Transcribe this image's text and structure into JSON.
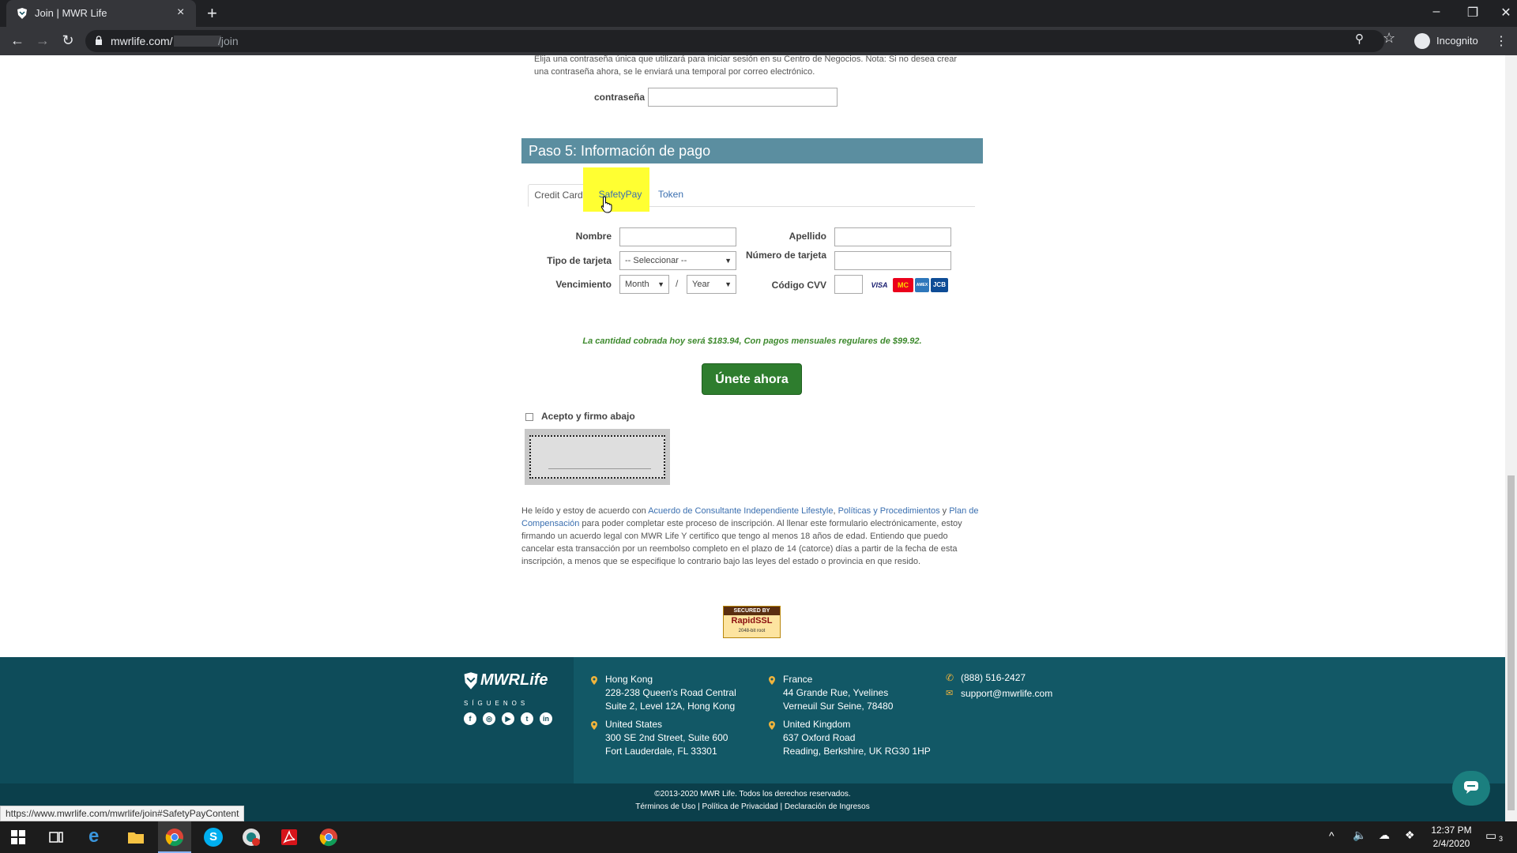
{
  "browser": {
    "tab_title": "Join | MWR Life",
    "url_host": "mwrlife.com/",
    "url_path": "/join",
    "incognito_label": "Incognito"
  },
  "page": {
    "password_note": "Elija una contraseña única que utilizará para iniciar sesión en su Centro de Negocios. Nota: Si no desea crear una contraseña ahora, se le enviará una temporal por correo electrónico.",
    "password_label": "contraseña",
    "step_title": "Paso 5: Información de pago",
    "tabs": [
      {
        "label": "Credit Card"
      },
      {
        "label": "SafetyPay"
      },
      {
        "label": "Token"
      }
    ],
    "form": {
      "nombre_label": "Nombre",
      "apellido_label": "Apellido",
      "tipo_label": "Tipo de tarjeta",
      "tipo_value": "-- Seleccionar --",
      "numero_label": "Número de tarjeta",
      "vencimiento_label": "Vencimiento",
      "month_value": "Month",
      "year_value": "Year",
      "slash": "/",
      "cvv_label": "Código CVV",
      "card_logos": [
        "VISA",
        "MC",
        "AMEX",
        "JCB"
      ]
    },
    "charge_note": "La cantidad cobrada hoy será $183.94, Con pagos mensuales regulares de $99.92.",
    "join_button": "Únete ahora",
    "accept_label": "Acepto y firmo abajo",
    "legal": {
      "part1": "He leído y estoy de acuerdo con ",
      "link1": "Acuerdo de Consultante Independiente Lifestyle",
      "sep1": ", ",
      "link2": "Políticas y Procedimientos",
      "sep2": " y ",
      "link3": "Plan de Compensación",
      "part2": " para poder completar este proceso de inscripción. Al llenar este formulario electrónicamente, estoy firmando un acuerdo legal con MWR Life Y certifico que tengo al menos 18 años de edad. Entiendo que puedo cancelar esta transacción por un reembolso completo en el plazo de 14 (catorce) días a partir de la fecha de esta inscripción, a menos que se especifique lo contrario bajo las leyes del estado o provincia en que resido."
    },
    "ssl_badge": {
      "top": "SECURED BY",
      "mid": "RapidSSL",
      "bot": "2048-bit root"
    }
  },
  "footer": {
    "logo_text": "MWRLife",
    "follow": "SÍGUENOS",
    "social": [
      "f",
      "◎",
      "▶",
      "t",
      "in"
    ],
    "offices": [
      {
        "city": "Hong Kong",
        "line1": "228-238 Queen's Road Central",
        "line2": "Suite 2, Level 12A, Hong Kong"
      },
      {
        "city": "United States",
        "line1": "300 SE 2nd Street, Suite 600",
        "line2": "Fort Lauderdale, FL 33301"
      },
      {
        "city": "France",
        "line1": "44 Grande Rue, Yvelines",
        "line2": "Verneuil Sur Seine, 78480"
      },
      {
        "city": "United Kingdom",
        "line1": "637 Oxford Road",
        "line2": "Reading, Berkshire, UK RG30 1HP"
      }
    ],
    "phone": "(888) 516-2427",
    "email": "support@mwrlife.com",
    "copyright": "©2013-2020 MWR Life. Todos los derechos reservados.",
    "links": "Términos de Uso | Política de Privacidad | Declaración de Ingresos"
  },
  "status_url": "https://www.mwrlife.com/mwrlife/join#SafetyPayContent",
  "taskbar": {
    "time": "12:37 PM",
    "date": "2/4/2020",
    "notifications": "3"
  },
  "colors": {
    "step_header": "#5b8ea0",
    "highlight": "#ffff32",
    "join_button": "#2e7d2e",
    "footer": "#0e4c5a"
  }
}
